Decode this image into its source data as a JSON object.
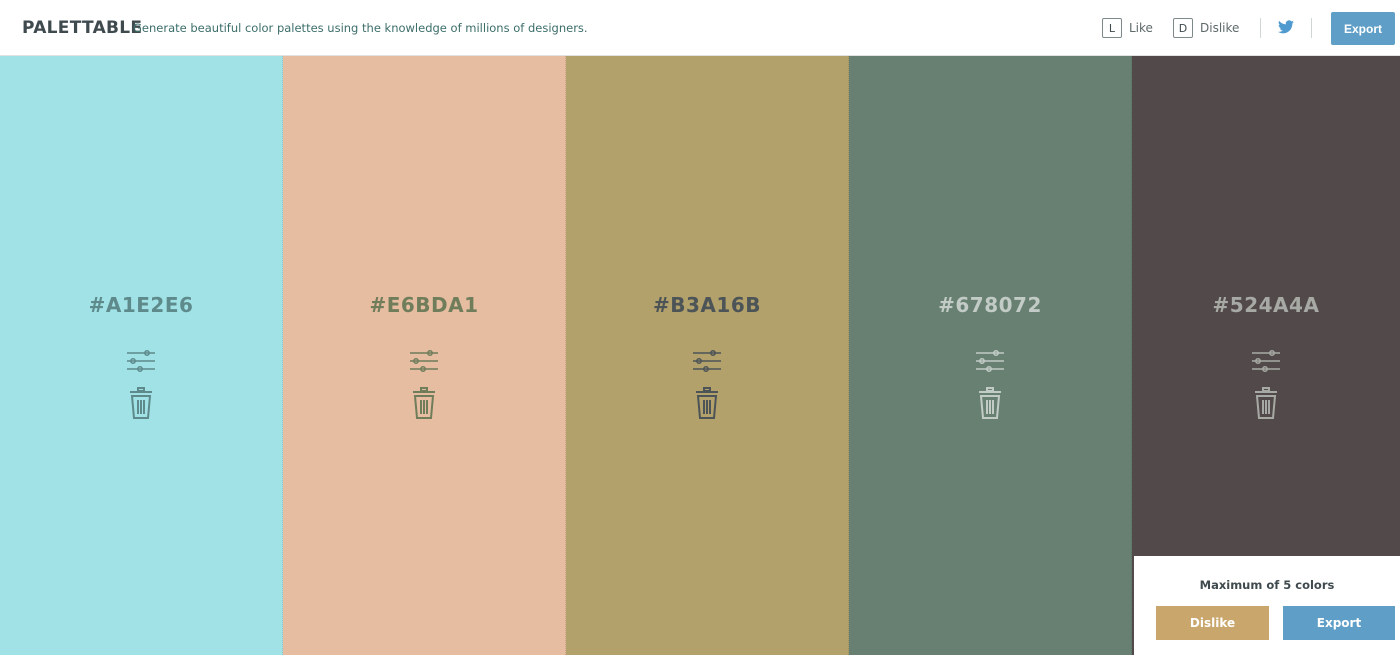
{
  "header": {
    "brand": "PALETTABLE",
    "tagline": "Generate beautiful color palettes using the knowledge of millions of designers.",
    "like_key": "L",
    "like_label": "Like",
    "dislike_key": "D",
    "dislike_label": "Dislike",
    "twitter_icon": "twitter-icon",
    "export_label": "Export"
  },
  "palette": [
    {
      "hex": "#A1E2E6",
      "bg": "#A1E2E6",
      "fg": "#5e8a8b"
    },
    {
      "hex": "#E6BDA1",
      "bg": "#E6BDA1",
      "fg": "#6f7d5b"
    },
    {
      "hex": "#B3A16B",
      "bg": "#B3A16B",
      "fg": "#4c5457"
    },
    {
      "hex": "#678072",
      "bg": "#678072",
      "fg": "#c2cbc6"
    },
    {
      "hex": "#524A4A",
      "bg": "#524A4A",
      "fg": "#a7a9a4"
    }
  ],
  "panel": {
    "message": "Maximum of 5 colors",
    "dislike_label": "Dislike",
    "export_label": "Export"
  },
  "colors": {
    "export_blue": "#5f9fc7",
    "dislike_gold": "#c9a66b"
  }
}
